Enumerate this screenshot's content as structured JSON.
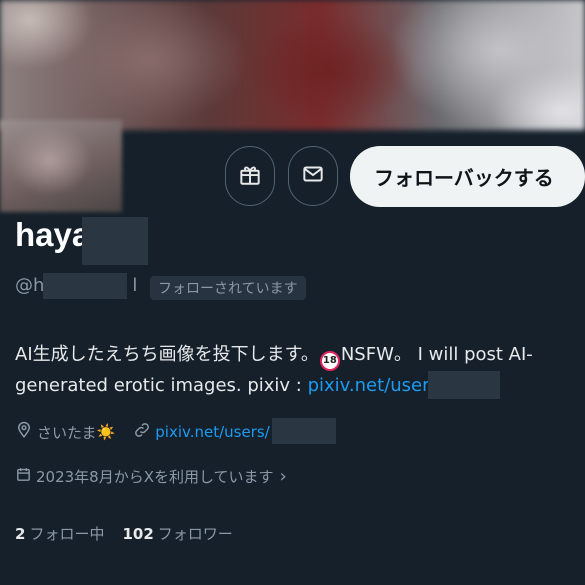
{
  "header": {
    "banner": "profile-banner",
    "avatar": "profile-avatar"
  },
  "actions": {
    "gift_icon": "gift-icon",
    "message_icon": "mail-icon",
    "follow_back_label": "フォローバックする"
  },
  "profile": {
    "display_name": "haya",
    "handle": "@h",
    "handle_suffix": "l",
    "follows_you_badge": "フォローされています",
    "bio_text": "AI生成したえちち画像を投下します。",
    "bio_nsfw_badge": "18",
    "bio_text_2": "NSFW。 I will post AI-generated erotic images. pixiv : ",
    "bio_link": "pixiv.net/users/",
    "location": "さいたま",
    "location_emoji": "☀️",
    "website": "pixiv.net/users/",
    "joined": "2023年8月からXを利用しています",
    "joined_chevron": "›"
  },
  "stats": {
    "following_count": "2",
    "following_label": "フォロー中",
    "followers_count": "102",
    "followers_label": "フォロワー"
  },
  "colors": {
    "background": "#15202b",
    "accent": "#1d9bf0",
    "muted": "#8b98a5"
  }
}
